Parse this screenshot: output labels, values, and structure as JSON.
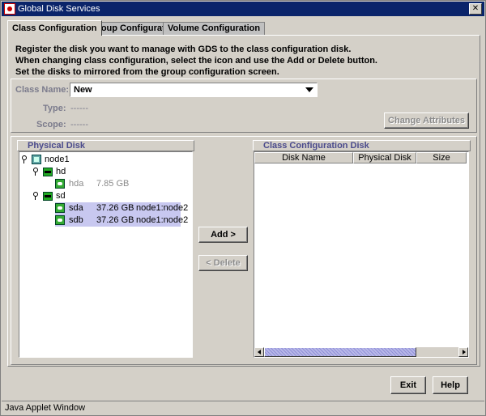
{
  "window": {
    "title": "Global Disk Services",
    "close_glyph": "✕",
    "status_text": "Java Applet Window"
  },
  "tabs": [
    {
      "label": "Class Configuration",
      "active": true
    },
    {
      "label": "Group Configuration",
      "active": false
    },
    {
      "label": "Volume Configuration",
      "active": false
    }
  ],
  "instructions": [
    "Register the disk you want to manage with GDS to the class configuration disk.",
    "When changing class configuration, select the icon and use the Add or Delete button.",
    "Set the disks to mirrored from the group configuration screen."
  ],
  "class_form": {
    "class_name_label": "Class Name:",
    "class_name_value": "New",
    "type_label": "Type:",
    "type_value": "------",
    "scope_label": "Scope:",
    "scope_value": "------",
    "change_attributes_label": "Change Attributes"
  },
  "physical_disk": {
    "header": "Physical Disk",
    "tree": {
      "node": "node1",
      "controllers": [
        {
          "name": "hd",
          "disks": [
            {
              "name": "hda",
              "size": "7.85 GB",
              "nodes": "",
              "selected": false,
              "grey": true
            }
          ]
        },
        {
          "name": "sd",
          "disks": [
            {
              "name": "sda",
              "size": "37.26 GB",
              "nodes": "node1:node2",
              "selected": true,
              "grey": false
            },
            {
              "name": "sdb",
              "size": "37.26 GB",
              "nodes": "node1:node2",
              "selected": true,
              "grey": false
            }
          ]
        }
      ]
    }
  },
  "actions": {
    "add_label": "Add >",
    "delete_label": "< Delete"
  },
  "class_config_disk": {
    "header": "Class Configuration Disk",
    "columns": [
      "Disk Name",
      "Physical Disk",
      "Size"
    ]
  },
  "footer": {
    "exit_label": "Exit",
    "help_label": "Help"
  },
  "icons": {
    "node": "server-node-icon",
    "controller": "controller-icon",
    "disk": "disk-icon"
  }
}
